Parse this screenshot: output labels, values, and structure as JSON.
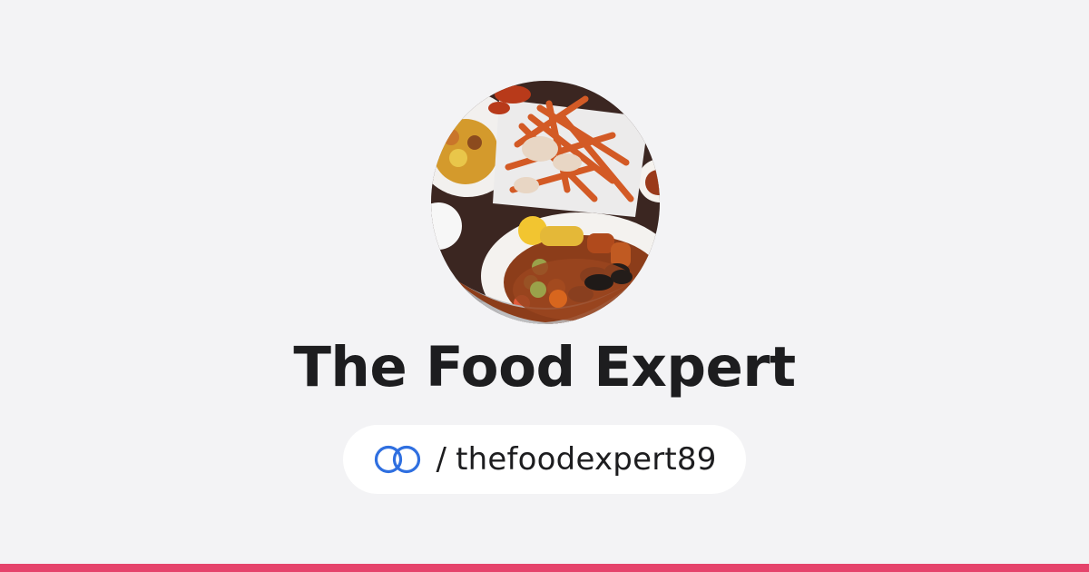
{
  "profile": {
    "name": "The Food Expert",
    "avatar_description_icon": "seafood-boil-photo"
  },
  "handle": {
    "separator": "/",
    "username": "thefoodexpert89",
    "icon": "linked-rings-icon"
  },
  "colors": {
    "background": "#f3f3f5",
    "title_text": "#1d1d1f",
    "pill_background": "#ffffff",
    "link_icon": "#2f6fe0",
    "accent_bar": "#e5436b"
  }
}
